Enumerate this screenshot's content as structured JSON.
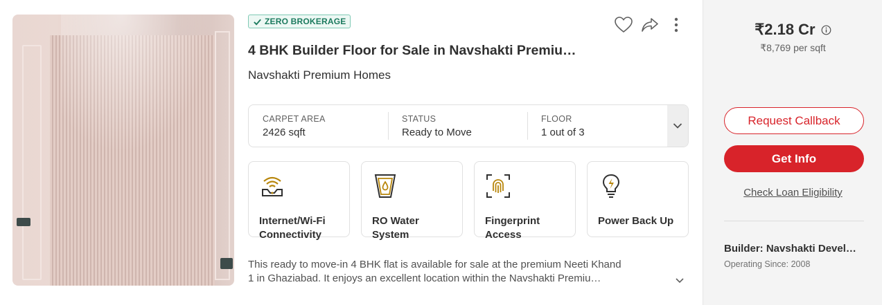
{
  "listing": {
    "badge": "ZERO BROKERAGE",
    "title": "4 BHK Builder Floor for Sale in Navshakti Premiu…",
    "project": "Navshakti Premium Homes",
    "specs": [
      {
        "label": "CARPET AREA",
        "value": "2426 sqft"
      },
      {
        "label": "STATUS",
        "value": "Ready to Move"
      },
      {
        "label": "FLOOR",
        "value": "1 out of 3"
      }
    ],
    "amenities": [
      {
        "label": "Internet/Wi-Fi Connectivity",
        "icon": "wifi-router-icon"
      },
      {
        "label": "RO Water System",
        "icon": "ro-water-icon"
      },
      {
        "label": "Fingerprint Access",
        "icon": "fingerprint-icon"
      },
      {
        "label": "Power Back Up",
        "icon": "bulb-power-icon"
      }
    ],
    "description_line1": "This ready to move-in 4 BHK flat is available for sale at the premium Neeti Khand",
    "description_line2": "1 in Ghaziabad. It enjoys an excellent location within the Navshakti Premiu…"
  },
  "pricing": {
    "price": "₹2.18 Cr",
    "per_sqft": "₹8,769 per sqft"
  },
  "actions": {
    "request_callback": "Request Callback",
    "get_info": "Get Info",
    "loan_link": "Check Loan Eligibility"
  },
  "builder": {
    "name": "Builder: Navshakti Devel…",
    "since": "Operating Since: 2008"
  },
  "colors": {
    "accent_red": "#d8232a",
    "badge_green": "#1b7a5e",
    "amenity_gold": "#b8860b"
  }
}
